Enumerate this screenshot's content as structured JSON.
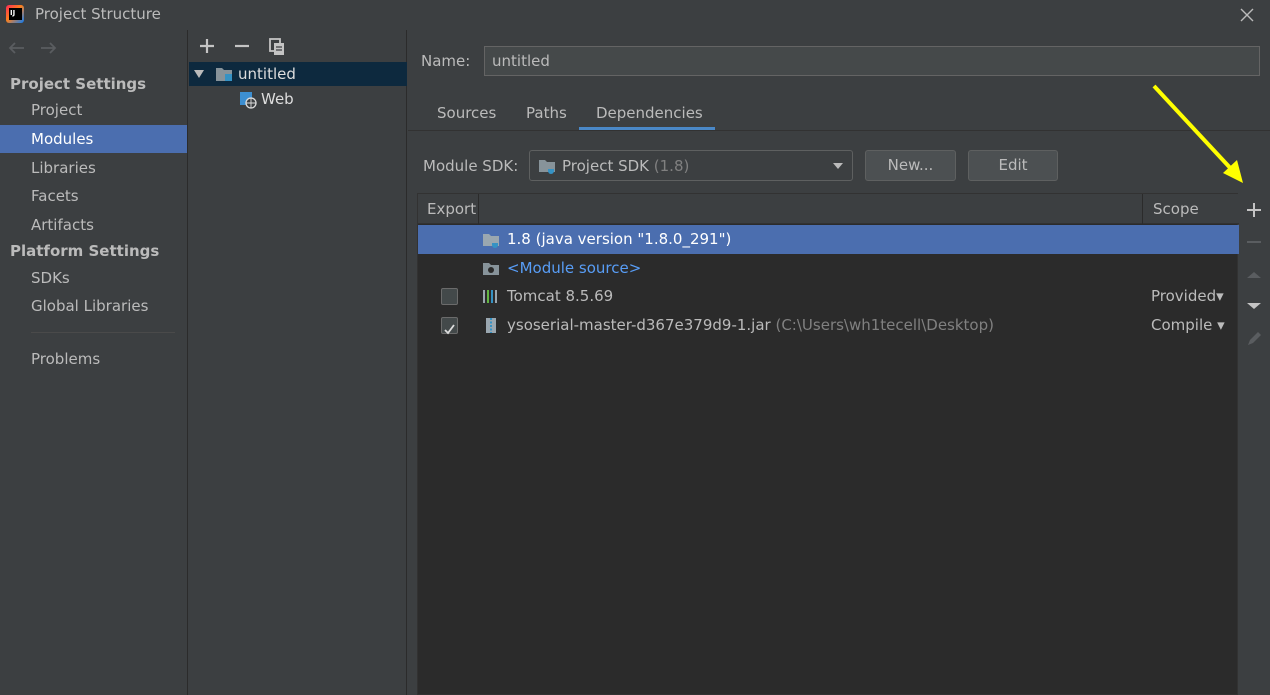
{
  "window": {
    "title": "Project Structure"
  },
  "nav": {
    "project_settings_header": "Project Settings",
    "platform_settings_header": "Platform Settings",
    "items": [
      {
        "label": "Project"
      },
      {
        "label": "Modules"
      },
      {
        "label": "Libraries"
      },
      {
        "label": "Facets"
      },
      {
        "label": "Artifacts"
      },
      {
        "label": "SDKs"
      },
      {
        "label": "Global Libraries"
      },
      {
        "label": "Problems"
      }
    ],
    "selected": "Modules"
  },
  "tree": {
    "items": [
      {
        "label": "untitled",
        "icon": "module-folder-icon",
        "expanded": true,
        "selected": true
      },
      {
        "label": "Web",
        "icon": "web-facet-icon"
      }
    ]
  },
  "detail": {
    "name_label": "Name:",
    "name_value": "untitled",
    "tabs": [
      {
        "label": "Sources"
      },
      {
        "label": "Paths"
      },
      {
        "label": "Dependencies"
      }
    ],
    "active_tab": "Dependencies",
    "module_sdk_label": "Module SDK:",
    "module_sdk_value": "Project SDK",
    "module_sdk_version": "(1.8)",
    "new_button": "New...",
    "edit_button": "Edit"
  },
  "dependencies": {
    "columns": {
      "export": "Export",
      "scope": "Scope"
    },
    "rows": [
      {
        "name": "1.8 (java version \"1.8.0_291\")",
        "icon": "jdk-folder-icon",
        "selected": true
      },
      {
        "name": "<Module source>",
        "icon": "module-source-icon",
        "link": true
      },
      {
        "name": "Tomcat 8.5.69",
        "icon": "library-icon",
        "export_checked": false,
        "scope": "Provided"
      },
      {
        "name": "ysoserial-master-d367e379d9-1.jar",
        "path": "(C:\\Users\\wh1tecell\\Desktop)",
        "icon": "jar-icon",
        "export_checked": true,
        "scope": "Compile"
      }
    ]
  },
  "colors": {
    "accent": "#4b6eaf",
    "tab_underline": "#4a88c7",
    "link": "#589df6",
    "annotation": "#ffff00"
  }
}
